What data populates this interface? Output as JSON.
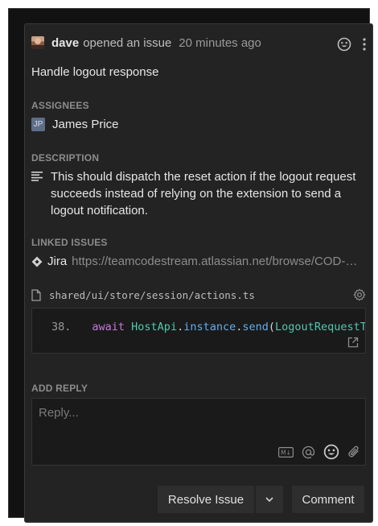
{
  "issue": {
    "author": "dave",
    "action": "opened an issue",
    "time": "20 minutes ago",
    "title": "Handle logout response"
  },
  "assignees": {
    "label": "ASSIGNEES",
    "items": [
      {
        "initials": "JP",
        "name": "James Price"
      }
    ]
  },
  "description": {
    "label": "DESCRIPTION",
    "text": "This should dispatch the reset action if the logout request succeeds instead of relying on the extension to send a logout notification."
  },
  "linked_issues": {
    "label": "LINKED ISSUES",
    "items": [
      {
        "provider": "Jira",
        "url": "https://teamcodestream.atlassian.net/browse/COD-…"
      }
    ]
  },
  "code": {
    "file_path": "shared/ui/store/session/actions.ts",
    "line_number": "38.",
    "tokens": {
      "keyword": "await",
      "class_name": "HostApi",
      "dot1": ".",
      "member": "instance",
      "dot2": ".",
      "method": "send",
      "paren": "(",
      "arg": "LogoutRequestType"
    }
  },
  "reply": {
    "label": "ADD REPLY",
    "placeholder": "Reply...",
    "markdown_badge": "M↓"
  },
  "buttons": {
    "resolve": "Resolve Issue",
    "comment": "Comment"
  },
  "icons": {
    "header": [
      "avatar",
      "emoji-icon",
      "more-vertical-icon"
    ],
    "reply": [
      "markdown-icon",
      "mention-icon",
      "emoji-icon",
      "attachment-icon"
    ]
  },
  "colors": {
    "background": "#232323",
    "keyword": "#c678dd",
    "class": "#4ec9b0",
    "method": "#61afef"
  }
}
